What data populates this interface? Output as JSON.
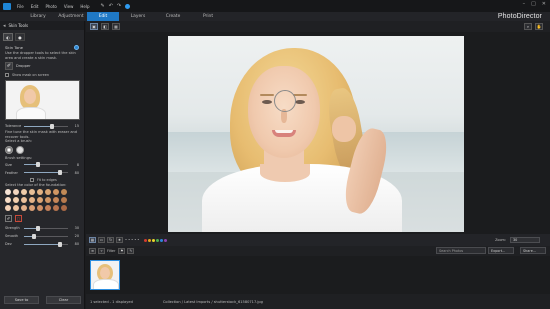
{
  "menu": [
    "File",
    "Edit",
    "Photo",
    "View",
    "Help"
  ],
  "tabs": [
    "Library",
    "Adjustment",
    "Edit",
    "Layers",
    "Create",
    "Print"
  ],
  "active_tab": "Edit",
  "brand": "PhotoDirector",
  "panel": {
    "title": "Skin Tools",
    "section_title": "Skin Tone",
    "instructions": "Use the dropper tools to select the skin area and create a skin mask.",
    "dropper_label": "Dropper",
    "show_mask_label": "Show mask on screen",
    "tolerance_label": "Tolerance",
    "tolerance_value": "15",
    "finetune_text": "Fine tune the skin mask with eraser and recover tools.",
    "brush_select_label": "Select a brush:",
    "brush_settings_label": "Brush settings:",
    "size_label": "Size",
    "size_value": "8",
    "feather_label": "Feather",
    "feather_value": "80",
    "fit_edges_label": "Fit to edges",
    "foundation_label": "Select the color of the foundation:",
    "swatch_colors": [
      "#f4e2d4",
      "#f1d6c0",
      "#eecba9",
      "#e8bf97",
      "#e3b283",
      "#d9a574",
      "#cf9663",
      "#c28a56",
      "#f6dcc6",
      "#f1cfae",
      "#ebc09a",
      "#e4b287",
      "#dba475",
      "#cf9565",
      "#c48658",
      "#b77a4d",
      "#f3d2b8",
      "#ecc29f",
      "#e3b08a",
      "#d99f76",
      "#cf8f66",
      "#c3805a",
      "#b6744f",
      "#a96946"
    ],
    "strength_label": "Strength",
    "strength_value": "30",
    "smooth_label": "Smooth",
    "smooth_value": "20",
    "dev_label": "Dev",
    "dev_value": "80",
    "save_label": "Save to",
    "clear_label": "Clear"
  },
  "toolbar": {
    "filter_label": "Filter",
    "zoom_label": "Zoom:",
    "zoom_value": "30",
    "search_placeholder": "Search Photos",
    "export_label": "Export...",
    "share_label": "Share...",
    "flag_colors": [
      "#d33b2f",
      "#e6a51d",
      "#e8d52a",
      "#4caf50",
      "#2e86de",
      "#8e44ad"
    ]
  },
  "status": {
    "selection": "1 selected - 1 displayed",
    "path": "Collection / Latest Imports / shutterstock_61580717.jpg"
  }
}
